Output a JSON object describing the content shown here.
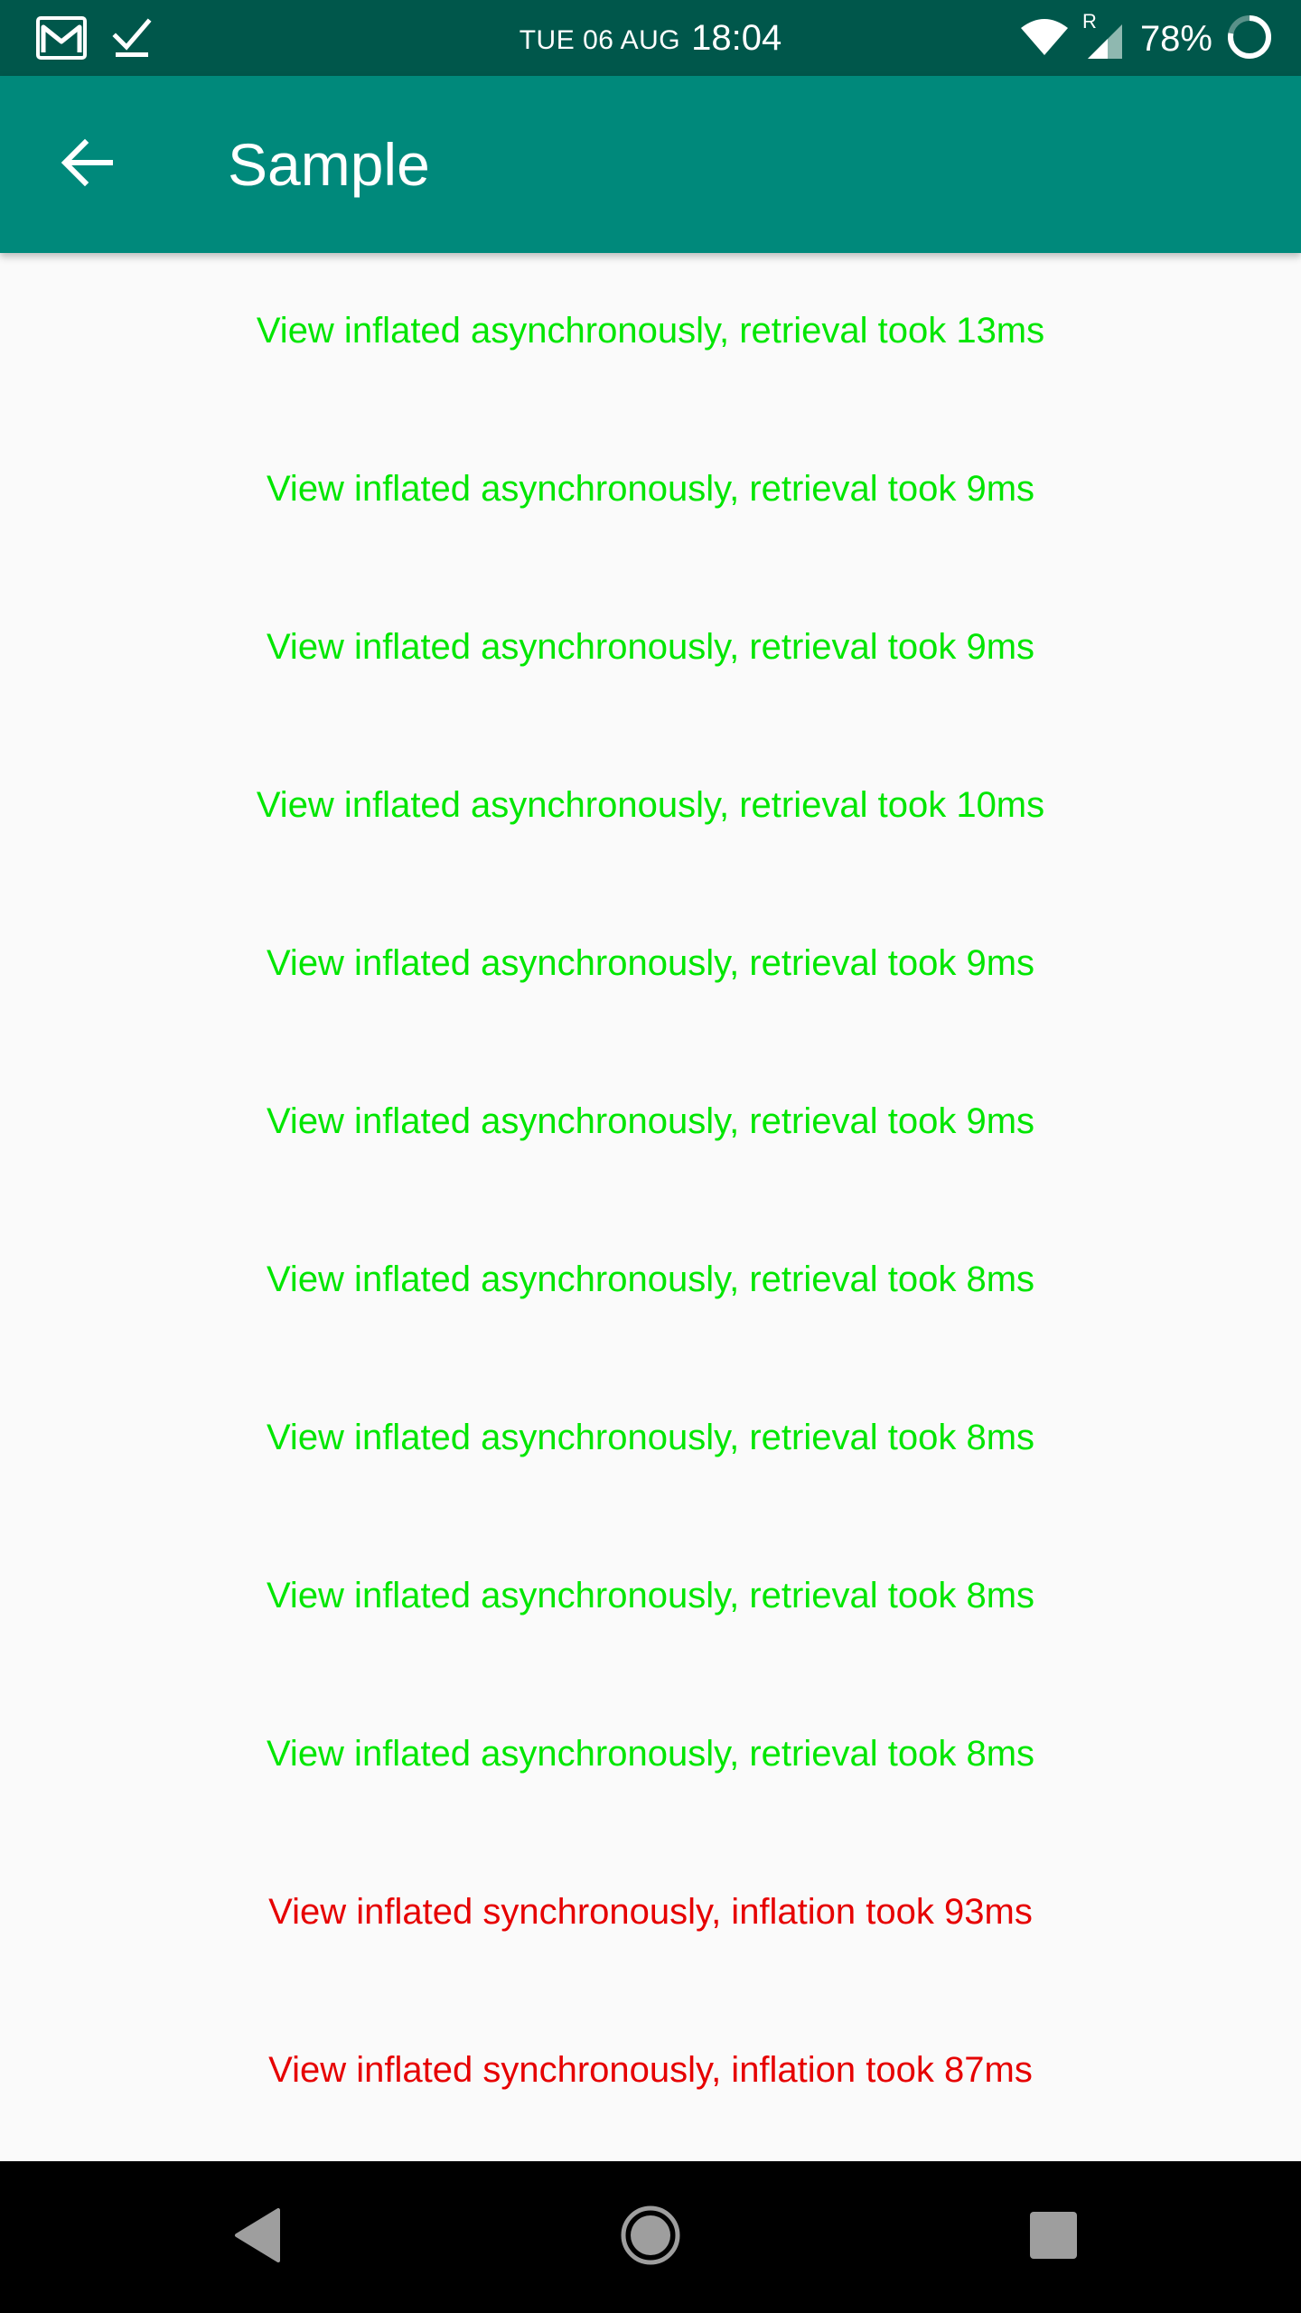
{
  "status_bar": {
    "date": "TUE 06 AUG",
    "time": "18:04",
    "battery": "78%",
    "roaming_indicator": "R",
    "icons": [
      "gmail-icon",
      "checkmark-icon",
      "wifi-icon",
      "cell-signal-icon",
      "battery-ring-icon"
    ]
  },
  "app_bar": {
    "title": "Sample",
    "back_icon": "arrow-back-icon"
  },
  "list": {
    "items": [
      {
        "text": "View inflated asynchronously, retrieval took 13ms",
        "kind": "async"
      },
      {
        "text": "View inflated asynchronously, retrieval took 9ms",
        "kind": "async"
      },
      {
        "text": "View inflated asynchronously, retrieval took 9ms",
        "kind": "async"
      },
      {
        "text": "View inflated asynchronously, retrieval took 10ms",
        "kind": "async"
      },
      {
        "text": "View inflated asynchronously, retrieval took 9ms",
        "kind": "async"
      },
      {
        "text": "View inflated asynchronously, retrieval took 9ms",
        "kind": "async"
      },
      {
        "text": "View inflated asynchronously, retrieval took 8ms",
        "kind": "async"
      },
      {
        "text": "View inflated asynchronously, retrieval took 8ms",
        "kind": "async"
      },
      {
        "text": "View inflated asynchronously, retrieval took 8ms",
        "kind": "async"
      },
      {
        "text": "View inflated asynchronously, retrieval took 8ms",
        "kind": "async"
      },
      {
        "text": "View inflated synchronously, inflation took 93ms",
        "kind": "sync"
      },
      {
        "text": "View inflated synchronously, inflation took 87ms",
        "kind": "sync"
      }
    ]
  },
  "nav_bar": {
    "icons": [
      "nav-back-icon",
      "nav-home-icon",
      "nav-recents-icon"
    ]
  },
  "colors": {
    "status_bar_bg": "#00574b",
    "app_bar_bg": "#00897b",
    "async_text": "#00e600",
    "sync_text": "#e60000",
    "background": "#fafafa",
    "nav_bar_bg": "#000000"
  }
}
